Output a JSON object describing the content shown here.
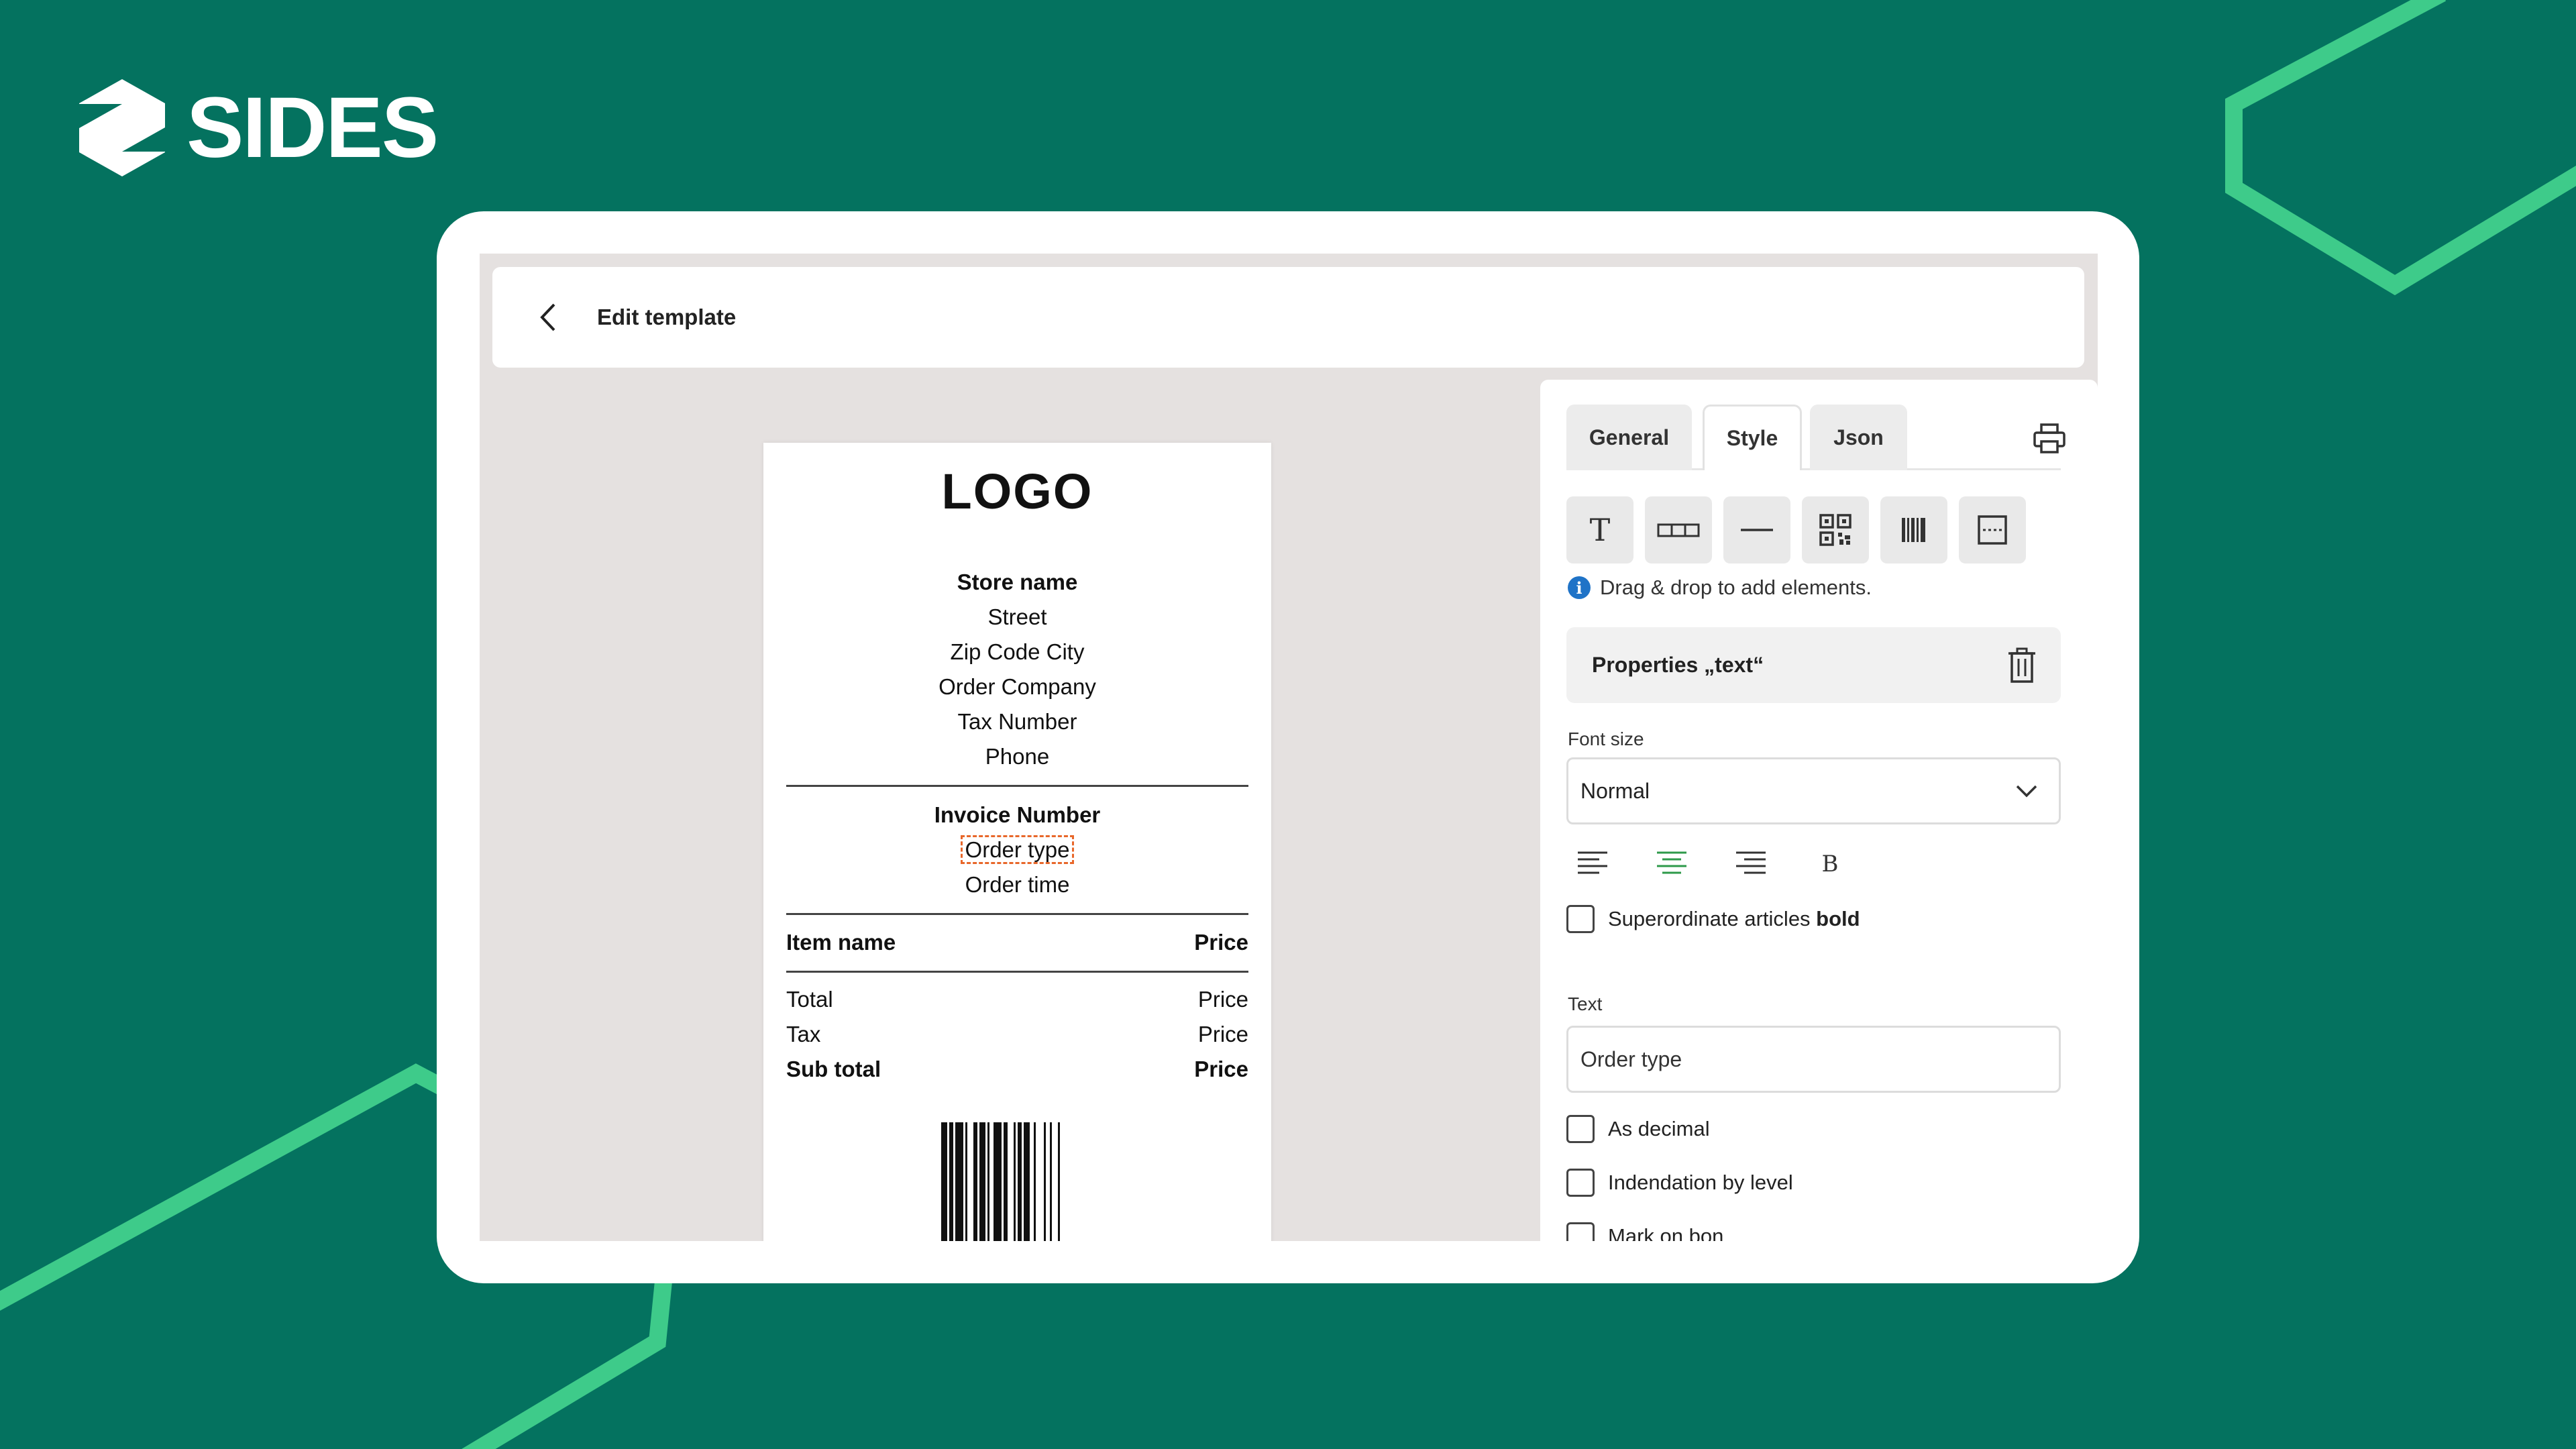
{
  "brand": {
    "name": "SIDES"
  },
  "colors": {
    "background": "#04725f",
    "accent_line": "#3ecb8a",
    "highlight": "#e8672a",
    "info": "#1f73c7",
    "active_align": "#2e9a4a"
  },
  "header": {
    "title": "Edit template"
  },
  "receipt": {
    "logo": "LOGO",
    "store_lines": [
      "Store name",
      "Street",
      "Zip Code City",
      "Order Company",
      "Tax Number",
      "Phone"
    ],
    "invoice_lines": [
      "Invoice Number",
      "Order type",
      "Order time"
    ],
    "table_header": {
      "name": "Item name",
      "price": "Price"
    },
    "totals": [
      {
        "label": "Total",
        "value": "Price"
      },
      {
        "label": "Tax",
        "value": "Price"
      },
      {
        "label": "Sub total",
        "value": "Price"
      }
    ]
  },
  "panel": {
    "tabs": [
      {
        "label": "General",
        "active": false
      },
      {
        "label": "Style",
        "active": true
      },
      {
        "label": "Json",
        "active": false
      }
    ],
    "tools": [
      "text-tool-icon",
      "table-tool-icon",
      "line-tool-icon",
      "qr-code-tool-icon",
      "barcode-tool-icon",
      "box-tool-icon"
    ],
    "hint": "Drag & drop to add elements.",
    "properties_title": "Properties „text“",
    "font_size_label": "Font size",
    "font_size_value": "Normal",
    "alignment": [
      "left",
      "center",
      "right",
      "bold"
    ],
    "alignment_selected": "center",
    "superordinate_label": "Superordinate articles ",
    "superordinate_bold": "bold",
    "text_label": "Text",
    "text_value": "Order type",
    "checkboxes": [
      "As decimal",
      "Indendation by level",
      "Mark on bon"
    ]
  }
}
